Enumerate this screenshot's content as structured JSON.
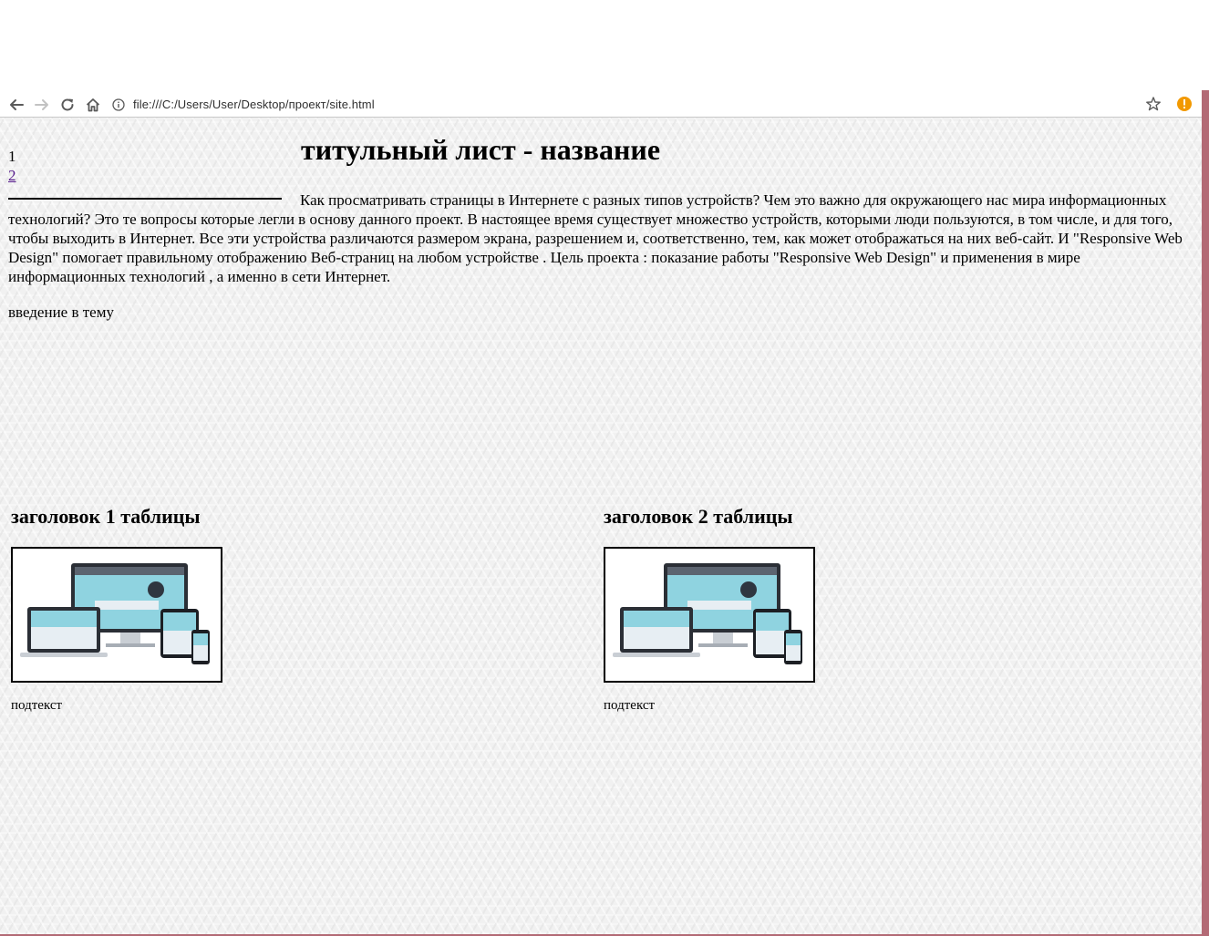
{
  "browser": {
    "url": "file:///C:/Users/User/Desktop/проект/site.html",
    "colors": {
      "frame_accent": "#b36a75",
      "alert": "#f29900"
    },
    "icons": [
      "back-arrow-icon",
      "forward-arrow-icon",
      "reload-icon",
      "home-icon",
      "info-icon",
      "star-icon",
      "alert-icon"
    ]
  },
  "page": {
    "nav": {
      "item1": "1",
      "item2": "2"
    },
    "title": "титульный лист - название",
    "intro": "Как просматривать страницы в Интернете с разных типов устройств? Чем это важно для окружающего нас мира информационных технологий? Это те вопросы которые легли в основу данного проект. В настоящее время существует множество устройств, которыми люди пользуются, в том числе, и для того, чтобы выходить в Интернет. Все эти устройства различаются размером экрана, разрешением и, соответственно, тем, как может отображаться на них веб-сайт. И \"Responsive Web Design\" помогает правильному отображению Веб-страниц на любом устройстве . Цель проекта : показание работы \"Responsive Web Design\" и применения в мире информационных технологий , а именно в сети Интернет.",
    "topic": "введение в тему",
    "cards": [
      {
        "heading": "заголовок 1 таблицы",
        "caption": "подтекст"
      },
      {
        "heading": "заголовок 2 таблицы",
        "caption": "подтекст"
      }
    ]
  }
}
